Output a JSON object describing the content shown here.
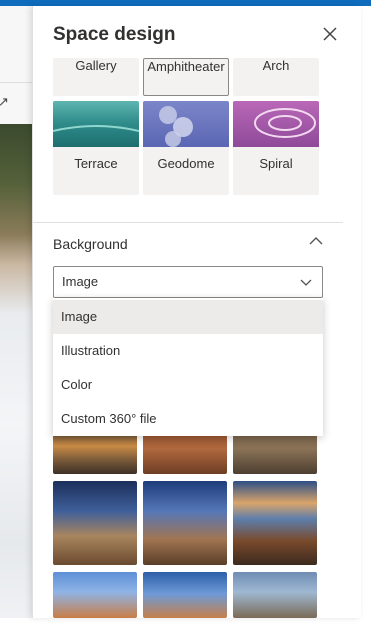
{
  "panel": {
    "title": "Space design",
    "close_icon": "close-icon",
    "templates": {
      "row1": [
        "Gallery",
        "Amphitheater",
        "Arch"
      ],
      "row2": [
        "Terrace",
        "Geodome",
        "Spiral"
      ],
      "selected": "Amphitheater"
    },
    "background": {
      "section_label": "Background",
      "dropdown_value": "Image",
      "options": [
        "Image",
        "Illustration",
        "Color",
        "Custom 360° file"
      ],
      "highlighted_option": "Image"
    }
  },
  "colors": {
    "accent_bar": "#0f6cbd",
    "tile_bg": "#f3f2f1",
    "menu_highlight": "#edebe9"
  }
}
